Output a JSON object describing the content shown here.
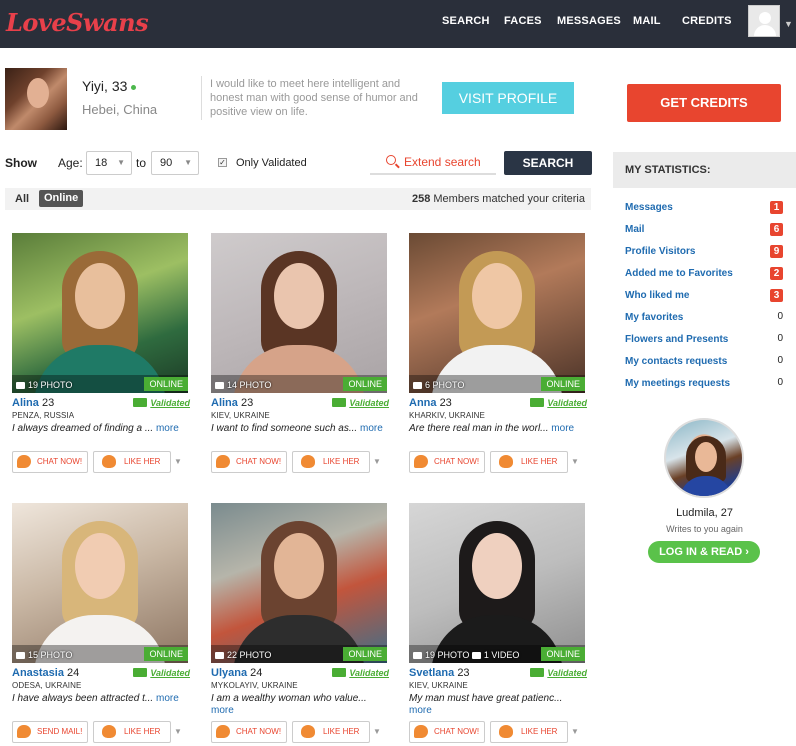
{
  "header": {
    "logo": "LoveSwans",
    "nav": [
      "SEARCH",
      "FACES",
      "MESSAGES",
      "MAIL",
      "CREDITS"
    ]
  },
  "profile": {
    "name": "Yiyi, 33",
    "location": "Hebei, China",
    "quote": "I would like to meet here intelligent and honest man with good sense of humor and positive view on life.",
    "visit_label": "VISIT PROFILE"
  },
  "credits_label": "GET CREDITS",
  "filters": {
    "show_label": "Show",
    "age_label": "Age:",
    "age_from": "18",
    "to_label": "to",
    "age_to": "90",
    "only_validated_label": "Only Validated",
    "extend_label": "Extend search",
    "search_label": "SEARCH"
  },
  "tabs": {
    "all": "All",
    "online": "Online",
    "count": "258",
    "count_text": " Members matched your criteria"
  },
  "cards": [
    {
      "name": "Alina",
      "age": "23",
      "location": "PENZA, RUSSIA",
      "desc": "I always dreamed of finding a ...",
      "more": "more",
      "photos": "19 PHOTO",
      "online": "ONLINE",
      "validated": "Validated",
      "chat": "CHAT NOW!",
      "like": "LIKE HER"
    },
    {
      "name": "Alina",
      "age": "23",
      "location": "KIEV, UKRAINE",
      "desc": "I want to find someone such as...",
      "more": "more",
      "photos": "14 PHOTO",
      "online": "ONLINE",
      "validated": "Validated",
      "chat": "CHAT NOW!",
      "like": "LIKE HER"
    },
    {
      "name": "Anna",
      "age": "23",
      "location": "KHARKIV, UKRAINE",
      "desc": "Are there real man in the worl...",
      "more": "more",
      "photos": "6 PHOTO",
      "online": "ONLINE",
      "validated": "Validated",
      "chat": "CHAT NOW!",
      "like": "LIKE HER"
    },
    {
      "name": "Anastasia",
      "age": "24",
      "location": "ODESA, UKRAINE",
      "desc": "I have always been attracted t...",
      "more": "more",
      "photos": "15 PHOTO",
      "online": "ONLINE",
      "validated": "Validated",
      "chat": "SEND MAIL!",
      "like": "LIKE HER"
    },
    {
      "name": "Ulyana",
      "age": "24",
      "location": "MYKOLAYIV, UKRAINE",
      "desc": "I am a wealthy woman who value...",
      "more": "more",
      "photos": "22 PHOTO",
      "online": "ONLINE",
      "validated": "Validated",
      "chat": "CHAT NOW!",
      "like": "LIKE HER"
    },
    {
      "name": "Svetlana",
      "age": "23",
      "location": "KIEV, UKRAINE",
      "desc": "My man must have great patienc...",
      "more": "more",
      "photos": "19 PHOTO",
      "videos": "1 VIDEO",
      "online": "ONLINE",
      "validated": "Validated",
      "chat": "CHAT NOW!",
      "like": "LIKE HER"
    }
  ],
  "sidebar": {
    "title": "MY STATISTICS:",
    "stats": [
      {
        "label": "Messages",
        "count": "1"
      },
      {
        "label": "Mail",
        "count": "6"
      },
      {
        "label": "Profile Visitors",
        "count": "9"
      },
      {
        "label": "Added me to Favorites",
        "count": "2"
      },
      {
        "label": "Who liked me",
        "count": "3"
      },
      {
        "label": "My favorites",
        "count": "0"
      },
      {
        "label": "Flowers and Presents",
        "count": "0"
      },
      {
        "label": "My contacts requests",
        "count": "0"
      },
      {
        "label": "My meetings requests",
        "count": "0"
      }
    ],
    "promo_name": "Ludmila, 27",
    "promo_sub": "Writes to you again",
    "promo_btn": "LOG IN & READ ›"
  }
}
